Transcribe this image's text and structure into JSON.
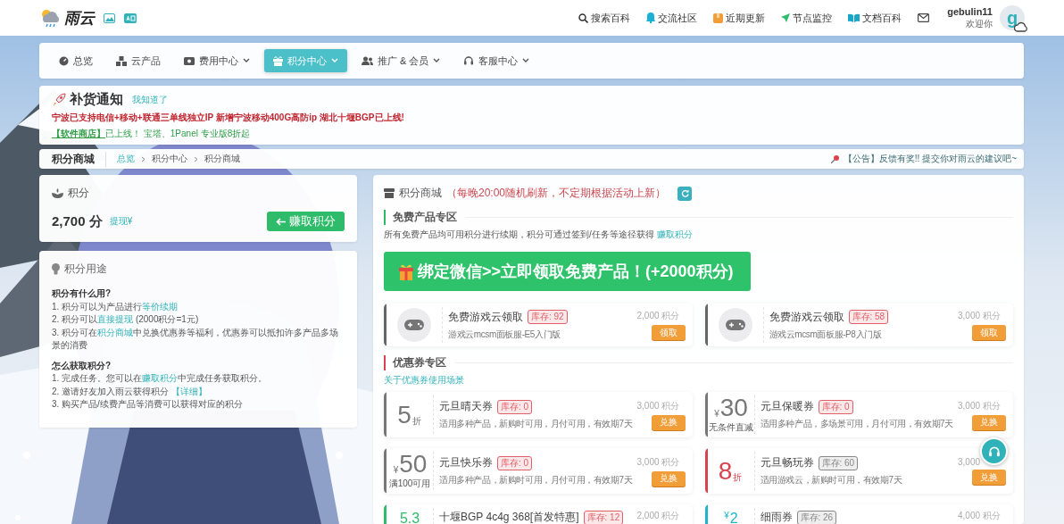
{
  "topbar": {
    "logo": "雨云",
    "links": [
      "搜索百科",
      "交流社区",
      "近期更新",
      "节点监控",
      "文档百科"
    ],
    "user": {
      "name": "gebulin11",
      "greeting": "欢迎你",
      "avatar": "g"
    }
  },
  "nav": [
    {
      "label": "总览",
      "dropdown": false,
      "selected": false
    },
    {
      "label": "云产品",
      "dropdown": false,
      "selected": false
    },
    {
      "label": "费用中心",
      "dropdown": true,
      "selected": false
    },
    {
      "label": "积分中心",
      "dropdown": true,
      "selected": true
    },
    {
      "label": "推广 & 会员",
      "dropdown": true,
      "selected": false
    },
    {
      "label": "客服中心",
      "dropdown": true,
      "selected": false
    }
  ],
  "notice": {
    "title": "补货通知",
    "dismiss": "我知道了",
    "alert": "宁波已支持电信+移动+联通三单线独立IP 新增宁波移动400G高防ip 湖北十堰BGP已上线!",
    "promo": {
      "link": "【软件商店】",
      "text": "已上线！ 宝塔、1Panel 专业版8折起"
    }
  },
  "breadcrumb": {
    "title": "积分商城",
    "path": [
      "总览",
      "积分中心",
      "积分商城"
    ],
    "announcement": "【公告】反馈有奖!! 提交你对雨云的建议吧~"
  },
  "points": {
    "title": "积分",
    "amount": "2,700 分",
    "withdraw": "提现¥",
    "earn_button": "赚取积分"
  },
  "usage": {
    "title": "积分用途",
    "sections": [
      {
        "heading": "积分有什么用?",
        "lines": [
          [
            {
              "kind": "text",
              "text": "1. 积分可以为产品进行"
            },
            {
              "kind": "link",
              "text": "等价续期"
            }
          ],
          [
            {
              "kind": "text",
              "text": "2. 积分可以"
            },
            {
              "kind": "link",
              "text": "直接提现"
            },
            {
              "kind": "text",
              "text": " (2000积分=1元)"
            }
          ],
          [
            {
              "kind": "text",
              "text": "3. 积分可在"
            },
            {
              "kind": "link",
              "text": "积分商城"
            },
            {
              "kind": "text",
              "text": "中兑换优惠券等福利，优惠券可以抵扣许多产品多场景的消费"
            }
          ]
        ]
      },
      {
        "heading": "怎么获取积分?",
        "lines": [
          [
            {
              "kind": "text",
              "text": "1. 完成任务。您可以在"
            },
            {
              "kind": "link",
              "text": "赚取积分"
            },
            {
              "kind": "text",
              "text": "中完成任务获取积分。"
            }
          ],
          [
            {
              "kind": "text",
              "text": "2. 邀请好友加入雨云获得积分 "
            },
            {
              "kind": "link",
              "text": "【详细】"
            }
          ],
          [
            {
              "kind": "text",
              "text": "3. 购买产品/续费产品等消费可以获得对应的积分"
            }
          ]
        ]
      }
    ]
  },
  "mall": {
    "title": "积分商城",
    "note": "（每晚20:00随机刷新，不定期根据活动上新）",
    "free_section": {
      "title": "免费产品专区",
      "desc": "所有免费产品均可用积分进行续期，积分可通过签到/任务等途径获得",
      "link": "赚取积分",
      "banner": "绑定微信>>立即领取免费产品！(+2000积分)",
      "products": [
        {
          "title": "免费游戏云领取",
          "stock": {
            "text": "库存: 92",
            "color": "#e0606a"
          },
          "desc": "游戏云mcsm面板服-E5入门版",
          "price": "2,000 积分",
          "button": "领取"
        },
        {
          "title": "免费游戏云领取",
          "stock": {
            "text": "库存: 58",
            "color": "#e0606a"
          },
          "desc": "游戏云mcsm面板服-P8入门版",
          "price": "3,000 积分",
          "button": "领取"
        }
      ]
    },
    "coupon_section": {
      "title": "优惠券专区",
      "link": "关于优惠券使用场景",
      "coupons": [
        {
          "kind": "discount",
          "value": "5",
          "unit": "折",
          "color": "#777777",
          "title": "元旦晴天券",
          "stock": {
            "text": "库存: 0",
            "color": "#e0606a"
          },
          "desc": "适用多种产品，新购时可用，月付可用，有效期7天",
          "price": "3,000 积分",
          "button": "兑换"
        },
        {
          "kind": "cash",
          "currency": "¥",
          "value": "30",
          "condition": "无条件直减",
          "color": "#777777",
          "title": "元旦保暖券",
          "stock": {
            "text": "库存: 0",
            "color": "#e0606a"
          },
          "desc": "适用多种产品，多场景可用，月付可用，有效期7天",
          "price": "3,000 积分",
          "button": "兑换"
        },
        {
          "kind": "cash",
          "currency": "¥",
          "value": "50",
          "condition": "满100可用",
          "color": "#777777",
          "title": "元旦快乐券",
          "stock": {
            "text": "库存: 0",
            "color": "#e0606a"
          },
          "desc": "适用多种产品，新购时可用，月付可用，有效期7天",
          "price": "3,000 积分",
          "button": "兑换"
        },
        {
          "kind": "discount",
          "value": "8",
          "unit": "折",
          "color": "#d9434f",
          "title": "元旦畅玩券",
          "stock": {
            "text": "库存: 60",
            "color": "#888888"
          },
          "desc": "适用游戏云，新购时可用，有效期7天",
          "price": "3,000",
          "button": "兑换"
        },
        {
          "kind": "discount",
          "value": "5.3",
          "color": "#2ebc6a",
          "title": "十堰BGP 4c4g 368[首发特惠]",
          "stock": {
            "text": "库存: 12",
            "color": "#e0606a"
          },
          "price": "2,000 积分"
        },
        {
          "kind": "cash",
          "currency": "¥",
          "value": "2",
          "color": "#1fb5c9",
          "title": "细雨券",
          "stock": {
            "text": "库存: 26",
            "color": "#888888"
          },
          "price": "4,000 积分"
        }
      ]
    }
  }
}
